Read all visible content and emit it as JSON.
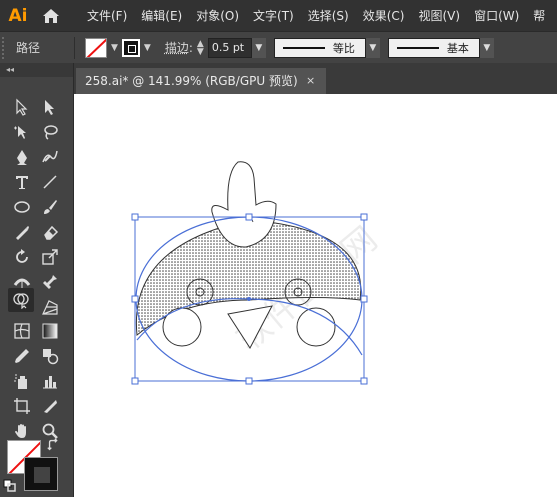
{
  "app": {
    "logo": "Ai"
  },
  "menu": [
    "文件(F)",
    "编辑(E)",
    "对象(O)",
    "文字(T)",
    "选择(S)",
    "效果(C)",
    "视图(V)",
    "窗口(W)",
    "帮"
  ],
  "control": {
    "path_label": "路径",
    "stroke_label": "描边",
    "stroke_weight": "0.5 pt",
    "profile_1": "等比",
    "profile_2": "基本"
  },
  "document": {
    "tab_title": "258.ai* @ 141.99% (RGB/GPU 预览)",
    "close": "×"
  },
  "toolbar": {
    "collapse": "◂◂"
  },
  "colors": {
    "accent": "#ff9a00",
    "selection": "#4a6fd6",
    "chrome": "#434343",
    "menubar": "#323232"
  }
}
